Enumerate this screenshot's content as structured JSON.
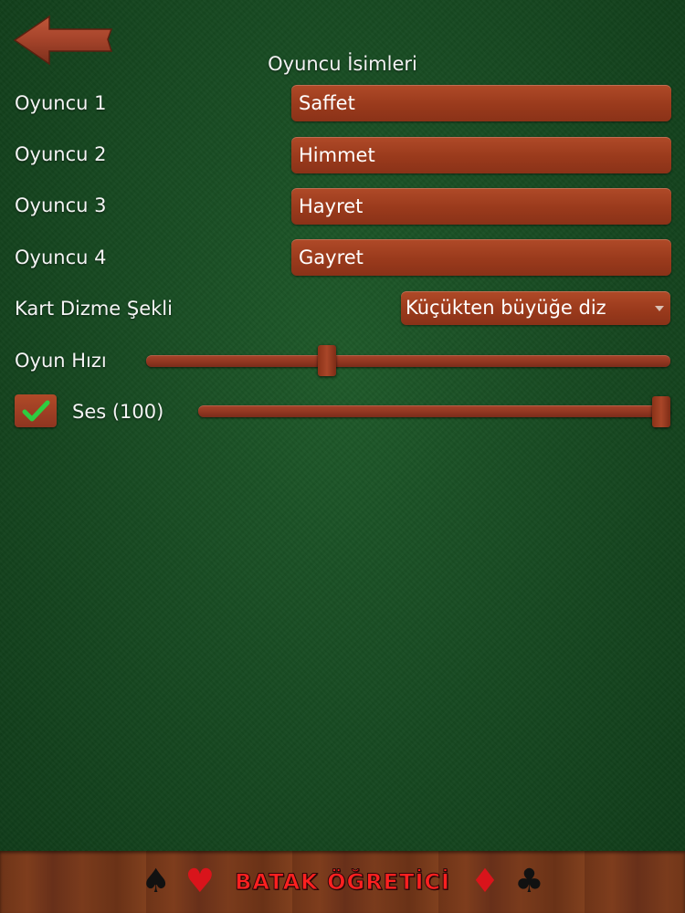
{
  "header": {
    "back_icon": "back-arrow-icon",
    "title": "Oyuncu İsimleri"
  },
  "players": [
    {
      "label": "Oyuncu 1",
      "value": "Saffet"
    },
    {
      "label": "Oyuncu 2",
      "value": "Himmet"
    },
    {
      "label": "Oyuncu 3",
      "value": "Hayret"
    },
    {
      "label": "Oyuncu 4",
      "value": "Gayret"
    }
  ],
  "card_sort": {
    "label": "Kart Dizme Şekli",
    "selected": "Küçükten büyüğe diz"
  },
  "game_speed": {
    "label": "Oyun Hızı",
    "value_fraction": 0.34
  },
  "sound": {
    "label": "Ses (100)",
    "checked": true,
    "value": 100
  },
  "footer": {
    "brand": "BATAK ÖĞRETİCİ",
    "suits": {
      "spade": "♠",
      "heart": "♥",
      "diamond": "♦",
      "club": "♣"
    }
  },
  "colors": {
    "felt": "#174a22",
    "wood": "#9a3a1c",
    "brand_text": "#ff2020",
    "check": "#2ecc40"
  }
}
